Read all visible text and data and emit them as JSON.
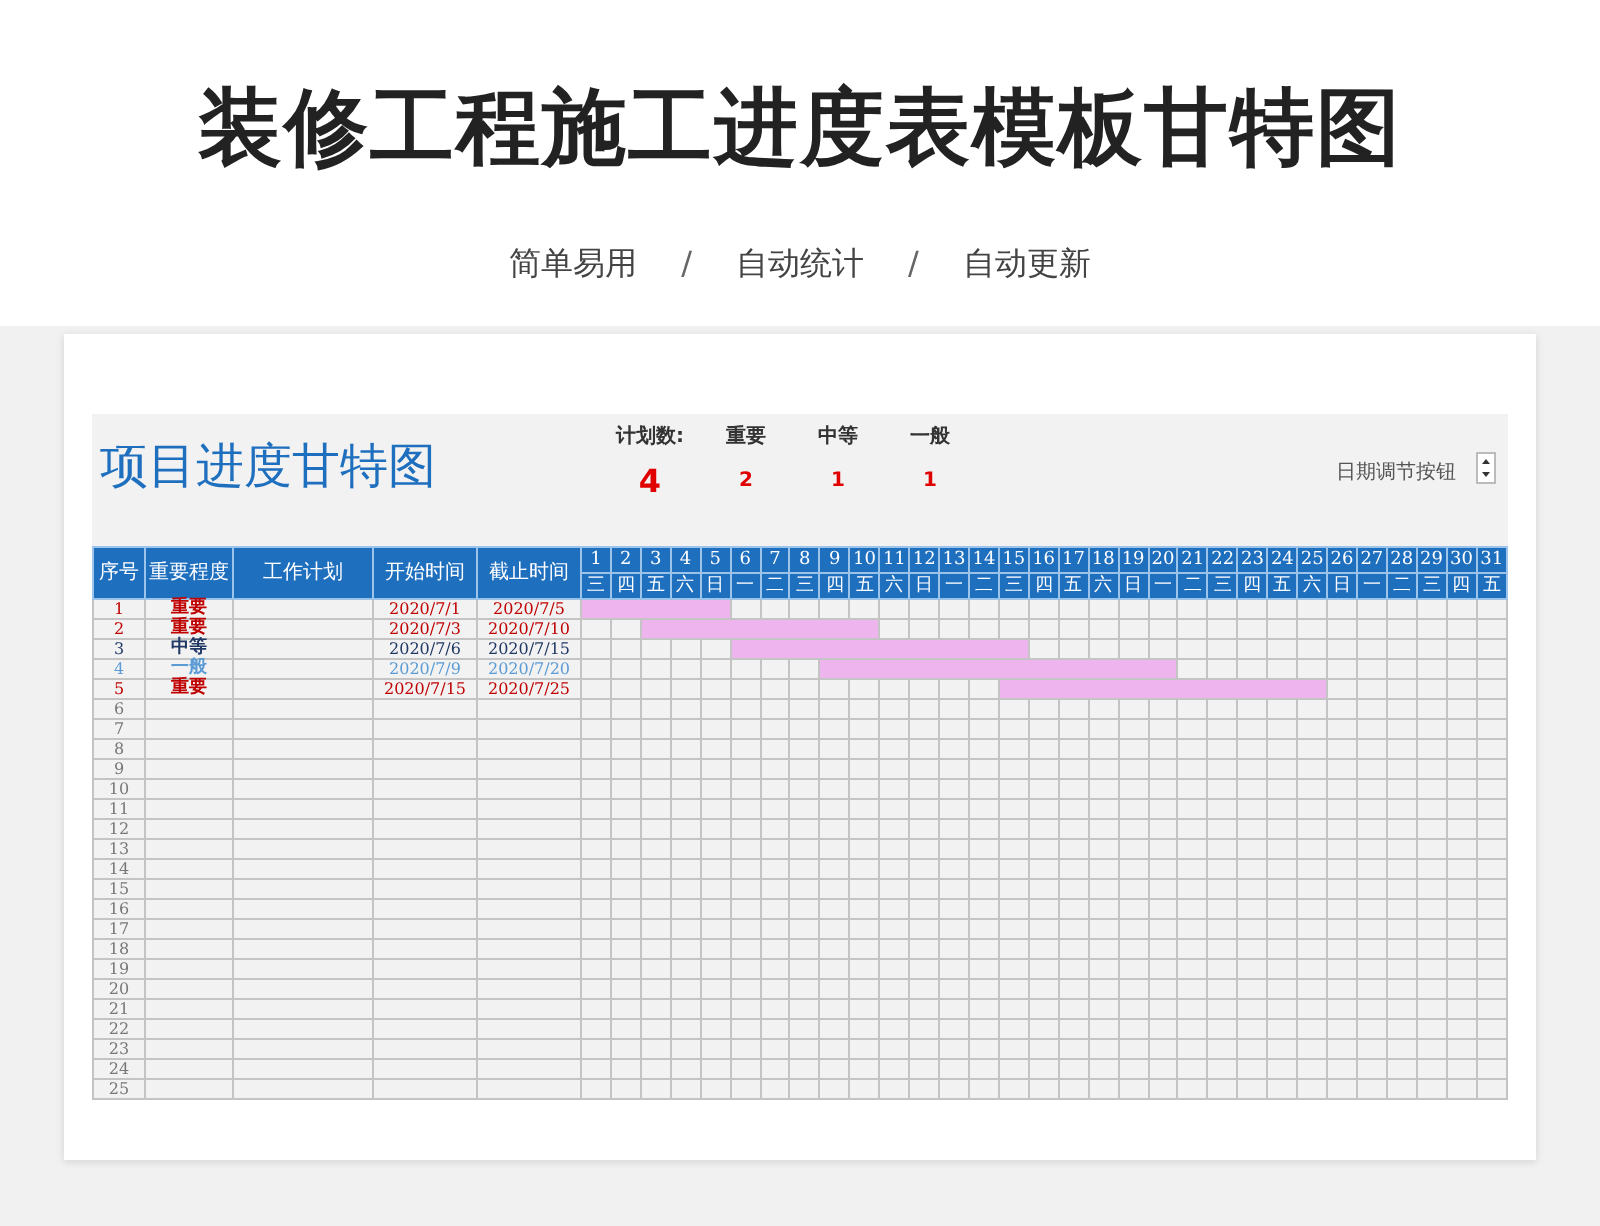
{
  "header": {
    "title": "装修工程施工进度表模板甘特图",
    "features": [
      "简单易用",
      "自动统计",
      "自动更新"
    ],
    "separators": [
      "/",
      "/"
    ]
  },
  "sheet": {
    "title": "项目进度甘特图",
    "plan_count_label": "计划数:",
    "plan_count": "4",
    "priority_counts": [
      {
        "label": "重要",
        "count": "2"
      },
      {
        "label": "中等",
        "count": "1"
      },
      {
        "label": "一般",
        "count": "1"
      }
    ],
    "date_button_label": "日期调节按钮",
    "columns": [
      "序号",
      "重要程度",
      "工作计划",
      "开始时间",
      "截止时间"
    ],
    "days": [
      {
        "date": "1",
        "weekday": "三"
      },
      {
        "date": "2",
        "weekday": "四"
      },
      {
        "date": "3",
        "weekday": "五"
      },
      {
        "date": "4",
        "weekday": "六"
      },
      {
        "date": "5",
        "weekday": "日"
      },
      {
        "date": "6",
        "weekday": "一"
      },
      {
        "date": "7",
        "weekday": "二"
      },
      {
        "date": "8",
        "weekday": "三"
      },
      {
        "date": "9",
        "weekday": "四"
      },
      {
        "date": "10",
        "weekday": "五"
      },
      {
        "date": "11",
        "weekday": "六"
      },
      {
        "date": "12",
        "weekday": "日"
      },
      {
        "date": "13",
        "weekday": "一"
      },
      {
        "date": "14",
        "weekday": "二"
      },
      {
        "date": "15",
        "weekday": "三"
      },
      {
        "date": "16",
        "weekday": "四"
      },
      {
        "date": "17",
        "weekday": "五"
      },
      {
        "date": "18",
        "weekday": "六"
      },
      {
        "date": "19",
        "weekday": "日"
      },
      {
        "date": "20",
        "weekday": "一"
      },
      {
        "date": "21",
        "weekday": "二"
      },
      {
        "date": "22",
        "weekday": "三"
      },
      {
        "date": "23",
        "weekday": "四"
      },
      {
        "date": "24",
        "weekday": "五"
      },
      {
        "date": "25",
        "weekday": "六"
      },
      {
        "date": "26",
        "weekday": "日"
      },
      {
        "date": "27",
        "weekday": "一"
      },
      {
        "date": "28",
        "weekday": "二"
      },
      {
        "date": "29",
        "weekday": "三"
      },
      {
        "date": "30",
        "weekday": "四"
      },
      {
        "date": "31",
        "weekday": "五"
      }
    ],
    "rows": [
      {
        "index": "1",
        "priority": "重要",
        "color": "#c00000",
        "start": "2020/7/1",
        "end": "2020/7/5"
      },
      {
        "index": "2",
        "priority": "重要",
        "color": "#c00000",
        "start": "2020/7/3",
        "end": "2020/7/10"
      },
      {
        "index": "3",
        "priority": "中等",
        "color": "#1f3864",
        "start": "2020/7/6",
        "end": "2020/7/15"
      },
      {
        "index": "4",
        "priority": "一般",
        "color": "#5b9bd5",
        "start": "2020/7/9",
        "end": "2020/7/20"
      },
      {
        "index": "5",
        "priority": "重要",
        "color": "#c00000",
        "start": "2020/7/15",
        "end": "2020/7/25"
      },
      {
        "index": "6"
      },
      {
        "index": "7"
      },
      {
        "index": "8"
      },
      {
        "index": "9"
      },
      {
        "index": "10"
      },
      {
        "index": "11"
      },
      {
        "index": "12"
      },
      {
        "index": "13"
      },
      {
        "index": "14"
      },
      {
        "index": "15"
      },
      {
        "index": "16"
      },
      {
        "index": "17"
      },
      {
        "index": "18"
      },
      {
        "index": "19"
      },
      {
        "index": "20"
      },
      {
        "index": "21"
      },
      {
        "index": "22"
      },
      {
        "index": "23"
      },
      {
        "index": "24"
      },
      {
        "index": "25"
      }
    ]
  }
}
